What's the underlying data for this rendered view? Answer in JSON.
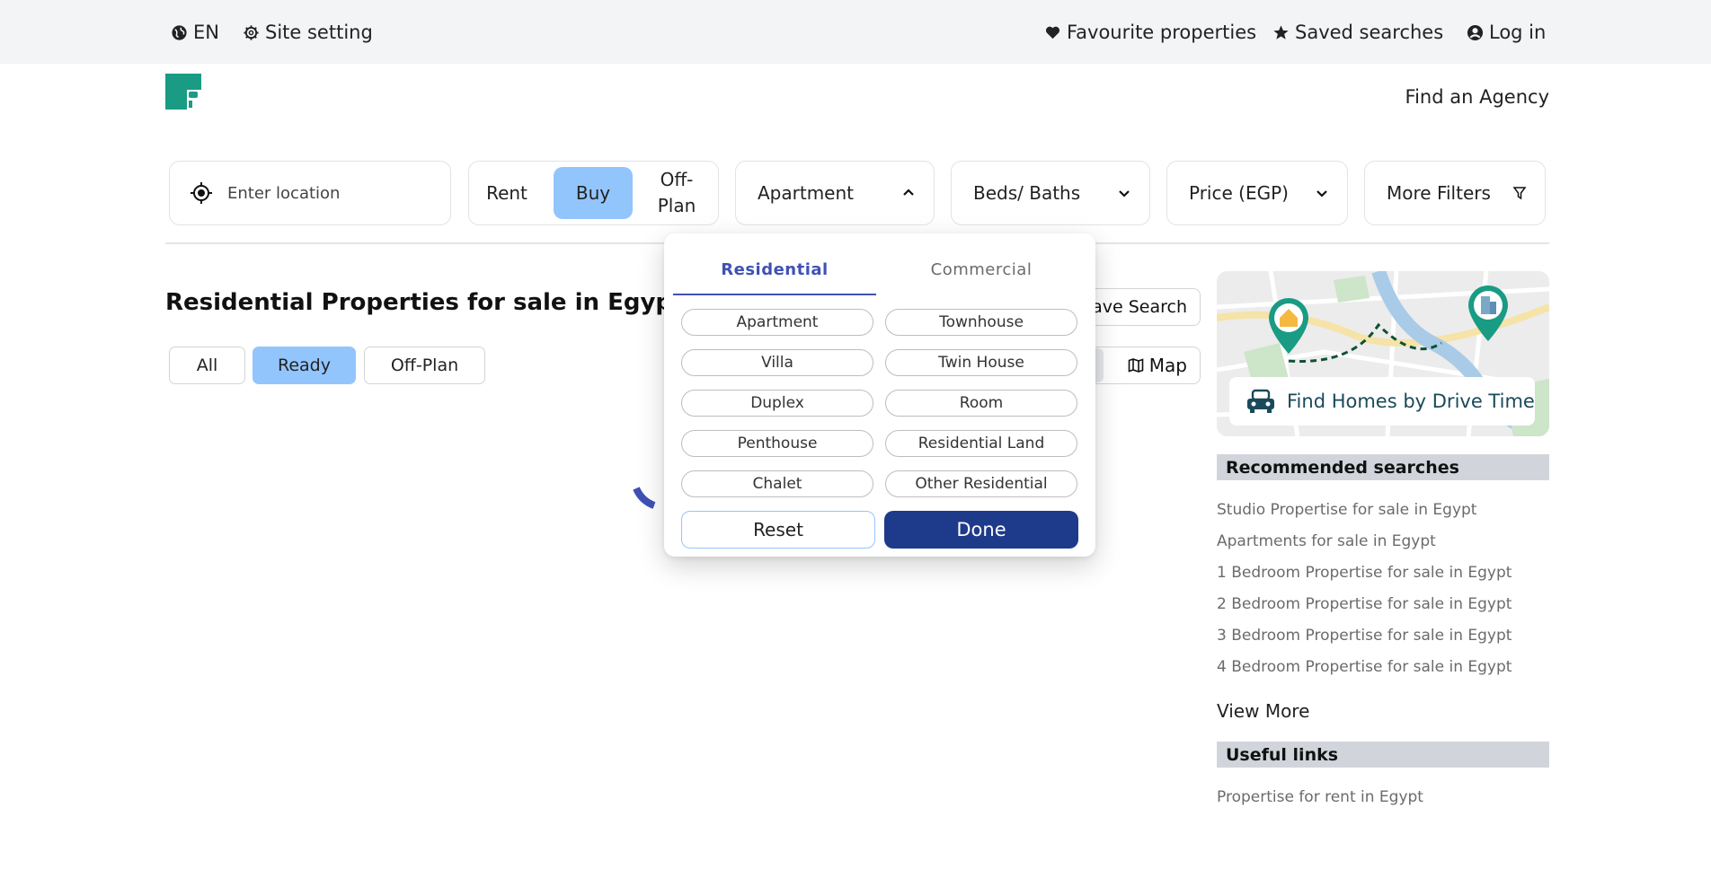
{
  "topbar": {
    "language": "EN",
    "site_setting": "Site setting",
    "favourites": "Favourite properties",
    "saved_searches": "Saved searches",
    "login": "Log in"
  },
  "header": {
    "find_agency": "Find an Agency"
  },
  "filters": {
    "location_placeholder": "Enter location",
    "purpose": [
      "Rent",
      "Buy",
      "Off-\nPlan"
    ],
    "purpose_selected": "Buy",
    "property_type": "Apartment",
    "beds_baths": "Beds/ Baths",
    "price": "Price (EGP)",
    "more_filters": "More Filters"
  },
  "page": {
    "title": "Residential Properties for sale in Egypt",
    "completion_pills": [
      "All",
      "Ready",
      "Off-Plan"
    ],
    "completion_selected": "Ready",
    "save_search": "Save Search",
    "map": "Map"
  },
  "dropdown": {
    "tabs": [
      "Residential",
      "Commercial"
    ],
    "active_tab": "Residential",
    "options_left": [
      "Apartment",
      "Villa",
      "Duplex",
      "Penthouse",
      "Chalet"
    ],
    "options_right": [
      "Townhouse",
      "Twin House",
      "Room",
      "Residential Land",
      "Other Residential"
    ],
    "reset": "Reset",
    "done": "Done"
  },
  "sidebar": {
    "drive_time": "Find Homes by Drive Time",
    "recommended_title": "Recommended searches",
    "recommended": [
      "Studio Propertise for sale in Egypt",
      "Apartments for sale in Egypt",
      "1 Bedroom Propertise for sale in Egypt",
      "2 Bedroom Propertise for sale in Egypt",
      "3 Bedroom Propertise for sale in Egypt",
      "4 Bedroom Propertise for sale in Egypt"
    ],
    "view_more": "View More",
    "useful_title": "Useful links",
    "useful": [
      "Propertise for rent in Egypt"
    ]
  },
  "colors": {
    "accent_blue": "#93c5fd",
    "primary_navy": "#1e3a8a",
    "tab_indigo": "#3f51b5",
    "brand_teal": "#1a9b83"
  }
}
